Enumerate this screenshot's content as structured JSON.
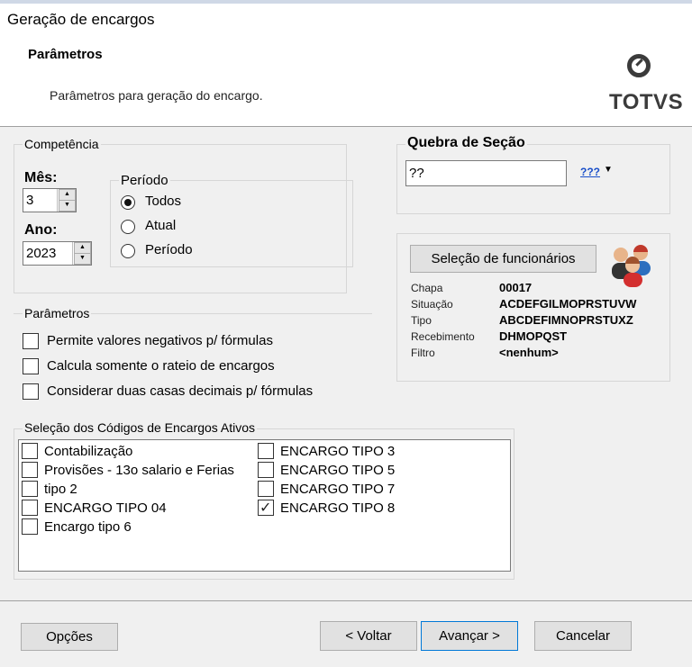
{
  "window": {
    "title": "Geração de encargos"
  },
  "header": {
    "title": "Parâmetros",
    "description": "Parâmetros para geração do encargo.",
    "logo_text": "TOTVS"
  },
  "competencia": {
    "legend": "Competência",
    "mes_label": "Mês:",
    "mes_value": "3",
    "ano_label": "Ano:",
    "ano_value": "2023",
    "periodo": {
      "legend": "Período",
      "options": [
        {
          "label": "Todos",
          "selected": true
        },
        {
          "label": "Atual",
          "selected": false
        },
        {
          "label": "Período",
          "selected": false
        }
      ]
    }
  },
  "quebra": {
    "legend": "Quebra de Seção",
    "value": "??",
    "lookup_label": "???"
  },
  "funcionarios": {
    "button_label": "Seleção de funcionários",
    "fields": [
      {
        "label": "Chapa",
        "value": "00017"
      },
      {
        "label": "Situação",
        "value": "ACDEFGILMOPRSTUVW"
      },
      {
        "label": "Tipo",
        "value": "ABCDEFIMNOPRSTUXZ"
      },
      {
        "label": "Recebimento",
        "value": "DHMOPQST"
      },
      {
        "label": "Filtro",
        "value": "<nenhum>"
      }
    ]
  },
  "parametros": {
    "legend": "Parâmetros",
    "options": [
      {
        "label": "Permite valores negativos p/ fórmulas",
        "checked": false
      },
      {
        "label": "Calcula somente o rateio de encargos",
        "checked": false
      },
      {
        "label": "Considerar duas casas decimais p/ fórmulas",
        "checked": false
      }
    ]
  },
  "encargos": {
    "legend": "Seleção dos Códigos de Encargos Ativos",
    "col1": [
      {
        "label": "Contabilização",
        "checked": false
      },
      {
        "label": "Provisões - 13o salario e Ferias",
        "checked": false
      },
      {
        "label": "tipo 2",
        "checked": false
      },
      {
        "label": "ENCARGO TIPO 04",
        "checked": false
      },
      {
        "label": "Encargo tipo 6",
        "checked": false
      }
    ],
    "col2": [
      {
        "label": "ENCARGO TIPO 3",
        "checked": false
      },
      {
        "label": "ENCARGO TIPO 5",
        "checked": false
      },
      {
        "label": "ENCARGO TIPO 7",
        "checked": false
      },
      {
        "label": "ENCARGO TIPO 8",
        "checked": true
      }
    ]
  },
  "footer": {
    "options_label": "Opções",
    "back_label": "< Voltar",
    "next_label": "Avançar >",
    "cancel_label": "Cancelar"
  }
}
